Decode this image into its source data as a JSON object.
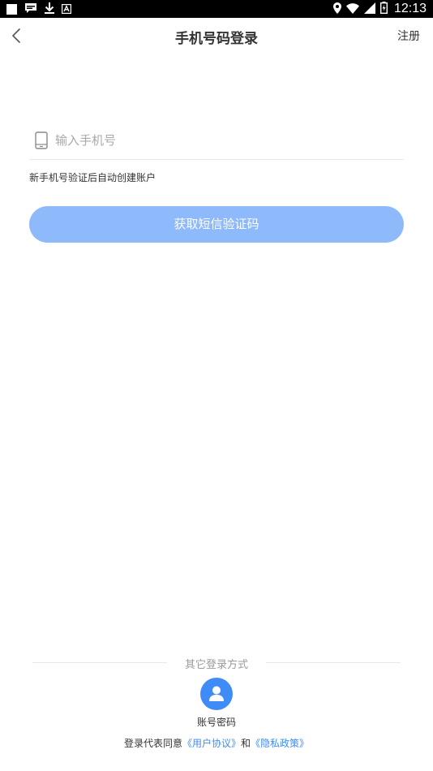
{
  "status_bar": {
    "time": "12:13",
    "left_icons": [
      "notification-square-icon",
      "chat-icon",
      "download-icon",
      "keyboard-icon"
    ],
    "right_icons": [
      "location-icon",
      "wifi-icon",
      "signal-icon",
      "battery-icon"
    ]
  },
  "header": {
    "title": "手机号码登录",
    "register_label": "注册",
    "back_icon": "chevron-left-icon"
  },
  "phone": {
    "placeholder": "输入手机号",
    "value": "",
    "icon": "phone-icon"
  },
  "hint": "新手机号验证后自动创建账户",
  "get_code_button": {
    "label": "获取短信验证码",
    "color": "#8ebafb"
  },
  "other_login": {
    "title": "其它登录方式",
    "account_password_label": "账号密码",
    "icon": "user-icon",
    "icon_color": "#3f8cf7"
  },
  "agreement": {
    "prefix": "登录代表同意",
    "user_agreement": "《用户协议》",
    "and": "和",
    "privacy_policy": "《隐私政策》",
    "link_color": "#3f8cf7"
  }
}
